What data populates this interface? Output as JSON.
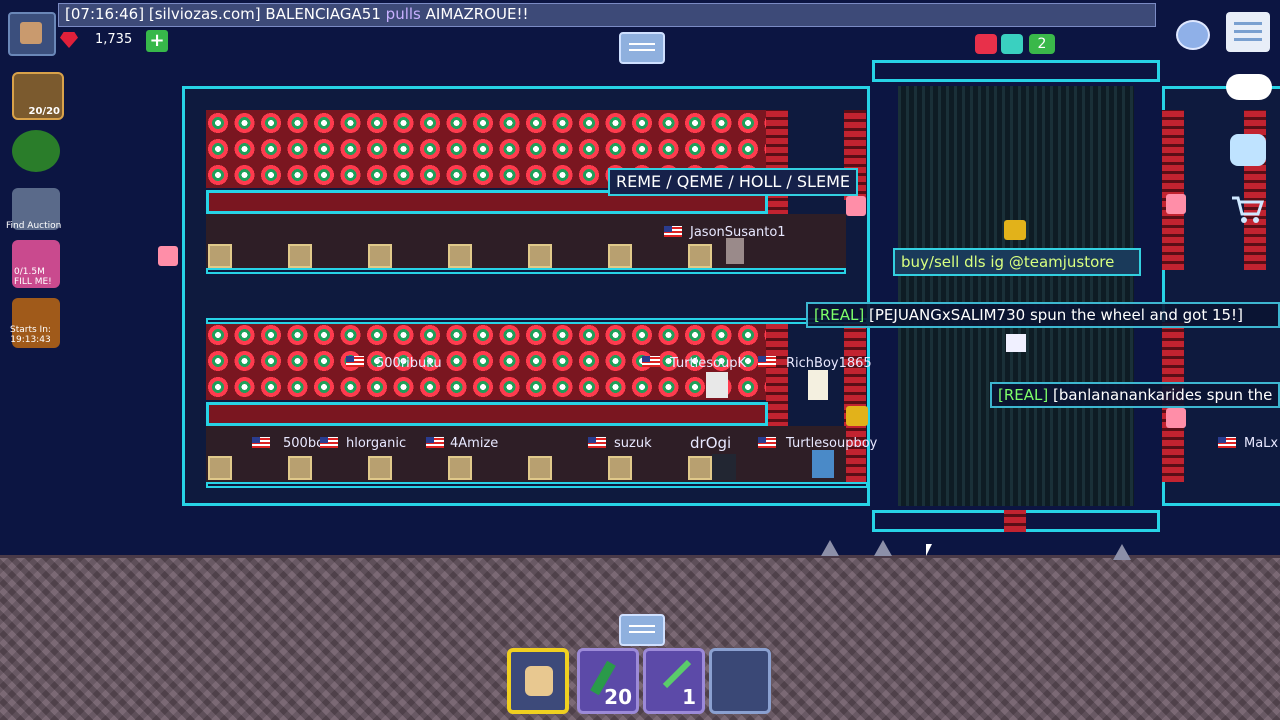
{
  "chat_banner": {
    "time": "[07:16:46]",
    "prefix": "[",
    "source": "[silviozas.com]",
    "player": "BALENCIAGA51",
    "action": "pulls",
    "target": "AIMAZROUE!!"
  },
  "gems": {
    "count": "1,735",
    "add_label": "+"
  },
  "sidebar": {
    "backpack_label": "20/20",
    "auction_label": "Find Auction",
    "piggy_label": "0/1.5M",
    "piggy_sub": "FILL ME!",
    "event_label": "Starts In:",
    "event_time": "19:13:43"
  },
  "signs": {
    "main": "REME / QEME / HOLL / SLEME",
    "buy": "buy/sell dls ig @teamjustore"
  },
  "broadcasts": [
    {
      "tag": "[REAL]",
      "text": "[PEJUANGxSALIM730 spun the wheel and got 15!]"
    },
    {
      "tag": "[REAL]",
      "text": "[banlananankarides spun the"
    }
  ],
  "players": [
    {
      "name": "JasonSusanto1"
    },
    {
      "name": "500ribuku"
    },
    {
      "name": "TurtlesoupK"
    },
    {
      "name": "RichBoy1865"
    },
    {
      "name": "500bc"
    },
    {
      "name": "hlorganic"
    },
    {
      "name": "4Amize"
    },
    {
      "name": "suzuk"
    },
    {
      "name": "drOgi"
    },
    {
      "name": "Turtlesoupboy"
    },
    {
      "name": "MaLx"
    }
  ],
  "hotbar": {
    "slot1": {
      "item": "fist",
      "count": ""
    },
    "slot2": {
      "item": "seed-item",
      "count": "20"
    },
    "slot3": {
      "item": "wrench",
      "count": "1"
    },
    "slot4": {
      "item": "empty",
      "count": ""
    }
  },
  "status_badge_count": "2",
  "icons": [
    "menu-icon",
    "globe-icon",
    "chat-bubble-icon",
    "emote-icon",
    "shop-cart-icon",
    "gem-icon",
    "lock-icon"
  ],
  "colors": {
    "accent_cyan": "#27d3e6",
    "sky": "#0c1542",
    "hotbar_selected": "#f0d020"
  }
}
